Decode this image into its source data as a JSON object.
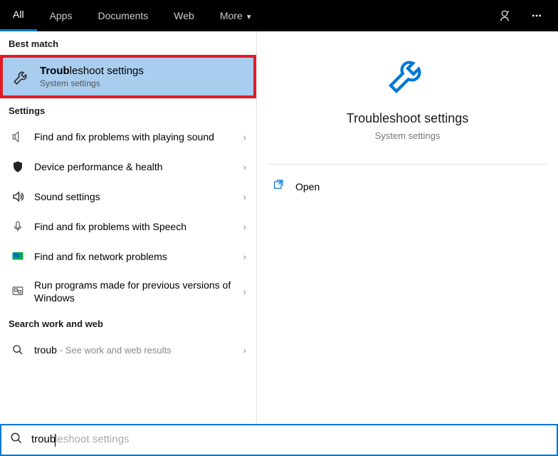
{
  "tabs": {
    "all": "All",
    "apps": "Apps",
    "documents": "Documents",
    "web": "Web",
    "more": "More"
  },
  "sections": {
    "best_match": "Best match",
    "settings": "Settings",
    "search_web": "Search work and web"
  },
  "best_match": {
    "title_prefix": "Troub",
    "title_rest": "leshoot settings",
    "subtitle": "System settings"
  },
  "settings_items": [
    {
      "label": "Find and fix problems with playing sound"
    },
    {
      "label": "Device performance & health"
    },
    {
      "label": "Sound settings"
    },
    {
      "label": "Find and fix problems with Speech"
    },
    {
      "label": "Find and fix network problems"
    },
    {
      "label": "Run programs made for previous versions of Windows"
    }
  ],
  "web_item": {
    "query": "troub",
    "hint": "See work and web results"
  },
  "preview": {
    "title": "Troubleshoot settings",
    "subtitle": "System settings",
    "open_label": "Open"
  },
  "search": {
    "typed": "troub",
    "ghost": "leshoot settings"
  }
}
